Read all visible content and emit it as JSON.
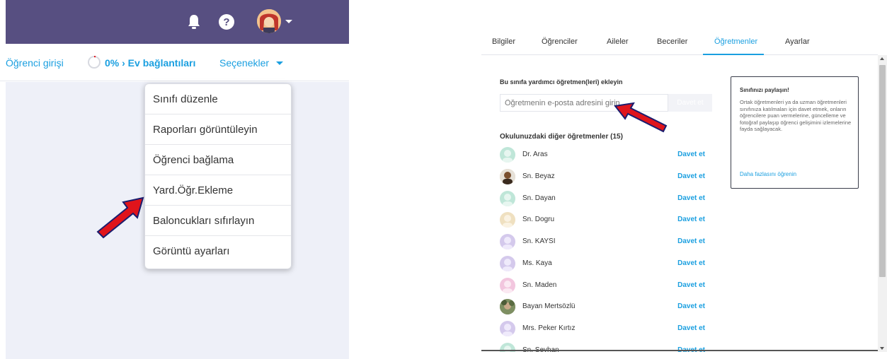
{
  "left_panel": {
    "topbar": {
      "icons": [
        "bell-icon",
        "help-icon",
        "user-avatar"
      ],
      "color": "#574f81"
    },
    "subbar": {
      "student_login": "Öğrenci girişi",
      "progress_percent": 0,
      "home_connections": "0% › Ev bağlantıları",
      "options": "Seçenekler"
    },
    "menu": {
      "items": [
        "Sınıfı düzenle",
        "Raporları görüntüleyin",
        "Öğrenci bağlama",
        "Yard.Öğr.Ekleme",
        "Baloncukları sıfırlayın",
        "Görüntü ayarları"
      ]
    }
  },
  "right_panel": {
    "tabs": [
      "Bilgiler",
      "Öğrenciler",
      "Aileler",
      "Beceriler",
      "Öğretmenler",
      "Ayarlar"
    ],
    "active_tab": "Öğretmenler",
    "add_label": "Bu sınıfa yardımcı öğretmen(leri) ekleyin",
    "email_placeholder": "Öğretmenin e-posta adresini girin",
    "invite_button": "Davet et",
    "others_title": "Okulunuzdaki diğer öğretmenler (15)",
    "teachers": [
      {
        "name": "Dr. Aras",
        "invite": "Davet et"
      },
      {
        "name": "Sn. Beyaz",
        "invite": "Davet et"
      },
      {
        "name": "Sn. Dayan",
        "invite": "Davet et"
      },
      {
        "name": "Sn. Dogru",
        "invite": "Davet et"
      },
      {
        "name": "Sn. KAYSI",
        "invite": "Davet et"
      },
      {
        "name": "Ms. Kaya",
        "invite": "Davet et"
      },
      {
        "name": "Sn. Maden",
        "invite": "Davet et"
      },
      {
        "name": "Bayan Mertsözlü",
        "invite": "Davet et"
      },
      {
        "name": "Mrs. Peker Kırtız",
        "invite": "Davet et"
      },
      {
        "name": "Sn. Seyhan",
        "invite": "Davet et"
      }
    ],
    "share_card": {
      "title": "Sınıfınızı paylaşın!",
      "body": "Ortak öğretmenleri ya da uzman öğretmenleri sınıfınıza katılmaları için davet etmek, onların öğrencilere puan vermelerine, güncelleme ve fotoğraf paylaşıp öğrenci gelişimini izlemelerine fayda sağlayacak.",
      "link": "Daha fazlasını öğrenin"
    }
  },
  "colors": {
    "accent": "#1a9fe0",
    "arrow": "#e0141b"
  }
}
